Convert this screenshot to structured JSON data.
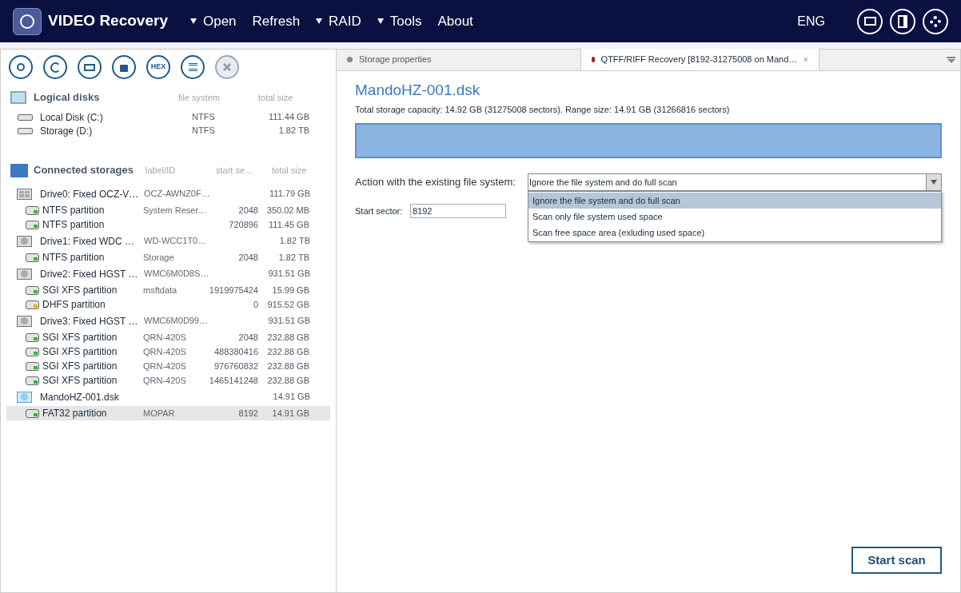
{
  "app": {
    "title": "VIDEO Recovery",
    "language": "ENG"
  },
  "toolbar": {
    "hex_label": "HEX"
  },
  "menu": [
    {
      "label": "Open",
      "dropdown": true
    },
    {
      "label": "Refresh",
      "dropdown": false
    },
    {
      "label": "RAID",
      "dropdown": true
    },
    {
      "label": "Tools",
      "dropdown": true
    },
    {
      "label": "About",
      "dropdown": false
    }
  ],
  "logical_disks": {
    "title": "Logical disks",
    "columns": [
      "file system",
      "total size"
    ],
    "items": [
      {
        "name": "Local Disk (C:)",
        "file_system": "NTFS",
        "size": "111.44 GB"
      },
      {
        "name": "Storage (D:)",
        "file_system": "NTFS",
        "size": "1.82 TB"
      }
    ]
  },
  "connected_storages": {
    "title": "Connected storages",
    "columns": [
      "label/ID",
      "start se…",
      "total size"
    ],
    "items": [
      {
        "kind": "ssd",
        "name": "Drive0: Fixed OCZ-V…",
        "label": "OCZ-AWNZ0F…",
        "size": "111.79 GB",
        "children": [
          {
            "name": "NTFS partition",
            "label": "System Reser…",
            "start": "2048",
            "size": "350.02 MB",
            "color": "#22c02a",
            "selected": false
          },
          {
            "name": "NTFS partition",
            "start": "720896",
            "size": "111.45 GB",
            "color": "#22c02a",
            "selected": false
          }
        ]
      },
      {
        "kind": "hdd",
        "name": "Drive1: Fixed WDC …",
        "label": "WD-WCC1T0…",
        "size": "1.82 TB",
        "children": [
          {
            "name": "NTFS partition",
            "label": "Storage",
            "start": "2048",
            "size": "1.82 TB",
            "color": "#22c02a",
            "selected": false
          }
        ]
      },
      {
        "kind": "hdd",
        "name": "Drive2: Fixed HGST …",
        "label": "WMC6M0D8S…",
        "size": "931.51 GB",
        "children": [
          {
            "name": "SGI XFS partition",
            "label": "msftdata",
            "start": "1919975424",
            "size": "15.99 GB",
            "color": "#22c02a",
            "selected": false
          },
          {
            "name": "DHFS partition",
            "start": "0",
            "size": "915.52 GB",
            "color": "#e8b400",
            "selected": false
          }
        ]
      },
      {
        "kind": "hdd",
        "name": "Drive3: Fixed HGST …",
        "label": "WMC6M0D99…",
        "size": "931.51 GB",
        "children": [
          {
            "name": "SGI XFS partition",
            "label": "QRN-420S",
            "start": "2048",
            "size": "232.88 GB",
            "color": "#22c02a",
            "selected": false
          },
          {
            "name": "SGI XFS partition",
            "label": "QRN-420S",
            "start": "488380416",
            "size": "232.88 GB",
            "color": "#22c02a",
            "selected": false
          },
          {
            "name": "SGI XFS partition",
            "label": "QRN-420S",
            "start": "976760832",
            "size": "232.88 GB",
            "color": "#22c02a",
            "selected": false
          },
          {
            "name": "SGI XFS partition",
            "label": "QRN-420S",
            "start": "1465141248",
            "size": "232.88 GB",
            "color": "#22c02a",
            "selected": false
          }
        ]
      },
      {
        "kind": "image",
        "name": "MandoHZ-001.dsk",
        "size": "14.91 GB",
        "children": [
          {
            "name": "FAT32 partition",
            "label": "MOPAR",
            "start": "8192",
            "size": "14.91 GB",
            "color": "#22c02a",
            "selected": true
          }
        ]
      }
    ]
  },
  "tabs": [
    {
      "label": "Storage properties",
      "selected": false,
      "closable": false
    },
    {
      "label": "QTFF/RIFF Recovery [8192-31275008 on Mand…",
      "selected": true,
      "closable": true
    }
  ],
  "content": {
    "title": "MandoHZ-001.dsk",
    "capacity": "Total storage capacity: 14.92 GB (31275008 sectors). Range size: 14.91 GB (31266816 sectors)",
    "action_label": "Action with the existing file system:",
    "action_value": "Ignore the file system and do full scan",
    "action_options": [
      {
        "label": "Ignore the file system and do full scan",
        "selected": true
      },
      {
        "label": "Scan only file system used space",
        "selected": false
      },
      {
        "label": "Scan free space area (exluding used space)",
        "selected": false
      }
    ],
    "start_sector_label": "Start sector:",
    "start_sector": "8192",
    "start_button": "Start scan"
  }
}
